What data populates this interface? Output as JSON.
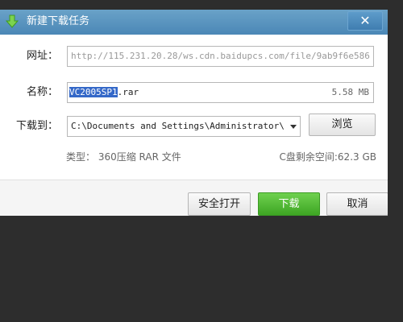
{
  "window": {
    "title": "新建下载任务",
    "close_label": "✕",
    "accent": "#4b87b6"
  },
  "form": {
    "url_label": "网址：",
    "url_value": "http://115.231.20.28/ws.cdn.baidupcs.com/file/9ab9f6e586",
    "name_label": "名称：",
    "name_selected": "VC2005SP1",
    "name_rest": ".rar",
    "file_size": "5.58 MB",
    "path_label": "下载到：",
    "path_value": "C:\\Documents and Settings\\Administrator\\",
    "browse_label": "浏览",
    "type_info": "类型： 360压缩 RAR 文件",
    "disk_info": "C盘剩余空间:62.3 GB"
  },
  "footer": {
    "open_label": "安全打开",
    "download_label": "下载",
    "cancel_label": "取消",
    "download_color": "#4bb52c"
  }
}
